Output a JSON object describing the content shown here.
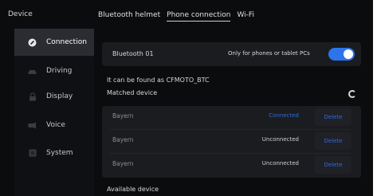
{
  "sidebar": {
    "title": "Device",
    "items": [
      {
        "label": "Connection",
        "icon": "link-icon",
        "active": true
      },
      {
        "label": "Driving",
        "icon": "car-icon",
        "active": false
      },
      {
        "label": "Display",
        "icon": "lock-icon",
        "active": false
      },
      {
        "label": "Voice",
        "icon": "voice-icon",
        "active": false
      },
      {
        "label": "System",
        "icon": "system-icon",
        "active": false
      }
    ]
  },
  "tabs": [
    {
      "label": "Bluetooth helmet",
      "active": false
    },
    {
      "label": "Phone connection",
      "active": true
    },
    {
      "label": "Wi-Fi",
      "active": false
    }
  ],
  "bluetooth": {
    "name": "Bluetooth 01",
    "hint": "Only for phones or tablet PCs",
    "enabled": true
  },
  "discoverable_text": "It can be found as CFMOTO_BTC",
  "matched": {
    "title": "Matched device",
    "devices": [
      {
        "name": "Bayern",
        "status": "Connected",
        "action": "Delete"
      },
      {
        "name": "Bayern",
        "status": "Unconnected",
        "action": "Delete"
      },
      {
        "name": "Bayern",
        "status": "Unconnected",
        "action": "Delete"
      }
    ]
  },
  "available_title": "Available device",
  "colors": {
    "accent": "#2c74ea",
    "background": "#0b0c0e",
    "panel": "#1b1c1f",
    "sidebar_active": "#2a2c31"
  }
}
